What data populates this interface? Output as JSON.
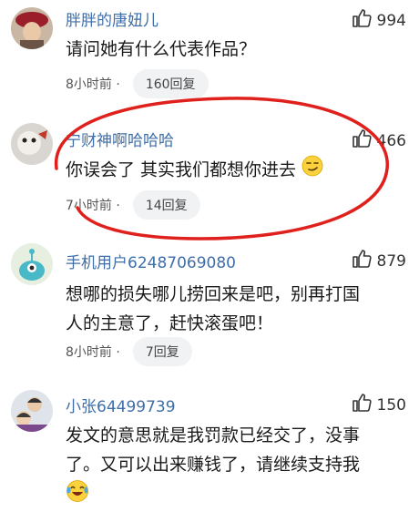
{
  "comments": [
    {
      "username": "胖胖的唐妞儿",
      "likes": "994",
      "text_lines": [
        "请问她有什么代表作品？"
      ],
      "time": "8小时前 ·",
      "replies": "160回复"
    },
    {
      "username": "宁财神啊哈哈哈",
      "likes": "466",
      "text_lines": [
        "你误会了 其实我们都想你进去"
      ],
      "time": "7小时前 ·",
      "replies": "14回复",
      "emoji": "smirk-emoji"
    },
    {
      "username": "手机用户62487069080",
      "likes": "879",
      "text_lines": [
        "想哪的损失哪儿捞回来是吧，别再打国",
        "人的主意了，赶快滚蛋吧！"
      ],
      "time": "8小时前 ·",
      "replies": "7回复"
    },
    {
      "username": "小张64499739",
      "likes": "150",
      "text_lines": [
        "发文的意思就是我罚款已经交了，没事",
        "了。又可以出来赚钱了，请继续支持我"
      ],
      "emoji": "laughing-crying-emoji"
    }
  ],
  "colors": {
    "username": "#3f6ea8",
    "annotation": "#e0201c",
    "pill_bg": "#f1f2f4"
  },
  "icons": [
    "thumbs-up-icon"
  ]
}
